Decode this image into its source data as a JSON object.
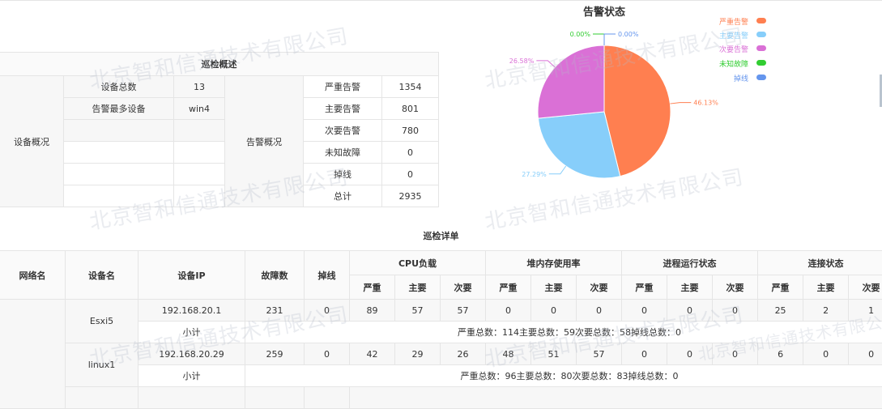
{
  "chart": {
    "title": "告警状态",
    "legend": [
      {
        "label": "严重告警",
        "color": "#ff7f50"
      },
      {
        "label": "主要告警",
        "color": "#87cefa"
      },
      {
        "label": "次要告警",
        "color": "#da70d6"
      },
      {
        "label": "未知故障",
        "color": "#32cd32"
      },
      {
        "label": "掉线",
        "color": "#6495ed"
      }
    ]
  },
  "chart_data": {
    "type": "pie",
    "title": "告警状态",
    "slices": [
      {
        "name": "严重告警",
        "value": 1354,
        "percent": "46.13%",
        "color": "#ff7f50"
      },
      {
        "name": "主要告警",
        "value": 801,
        "percent": "27.29%",
        "color": "#87cefa"
      },
      {
        "name": "次要告警",
        "value": 780,
        "percent": "26.58%",
        "color": "#da70d6"
      },
      {
        "name": "未知故障",
        "value": 0,
        "percent": "0.00%",
        "color": "#32cd32"
      },
      {
        "name": "掉线",
        "value": 0,
        "percent": "0.00%",
        "color": "#6495ed"
      }
    ],
    "legend_position": "top-right"
  },
  "summary": {
    "title": "巡检概述",
    "device_group": "设备概况",
    "device_rows": [
      {
        "label": "设备总数",
        "value": "13"
      },
      {
        "label": "告警最多设备",
        "value": "win4"
      }
    ],
    "alarm_group": "告警概况",
    "alarm_rows": [
      {
        "label": "严重告警",
        "value": "1354"
      },
      {
        "label": "主要告警",
        "value": "801"
      },
      {
        "label": "次要告警",
        "value": "780"
      },
      {
        "label": "未知故障",
        "value": "0"
      },
      {
        "label": "掉线",
        "value": "0"
      },
      {
        "label": "总计",
        "value": "2935"
      }
    ]
  },
  "detail": {
    "title": "巡检详单",
    "headers": {
      "network": "网络名",
      "device": "设备名",
      "ip": "设备IP",
      "faults": "故障数",
      "offline": "掉线",
      "cpu": "CPU负载",
      "heap": "堆内存使用率",
      "process": "进程运行状态",
      "connection": "连接状态",
      "severe": "严重",
      "major": "主要",
      "minor": "次要"
    },
    "rows": [
      {
        "device": "Esxi5",
        "ip": "192.168.20.1",
        "faults": "231",
        "offline": "0",
        "values": [
          "89",
          "57",
          "57",
          "0",
          "0",
          "0",
          "0",
          "0",
          "0",
          "25",
          "2",
          "1"
        ],
        "subtotal_label": "小计",
        "subtotal_text": "严重总数：114主要总数：59次要总数：58掉线总数：0"
      },
      {
        "device": "linux1",
        "ip": "192.168.20.29",
        "faults": "259",
        "offline": "0",
        "values": [
          "42",
          "29",
          "26",
          "48",
          "51",
          "57",
          "0",
          "0",
          "0",
          "6",
          "0",
          "0"
        ],
        "subtotal_label": "小计",
        "subtotal_text": "严重总数：96主要总数：80次要总数：83掉线总数：0"
      }
    ]
  },
  "watermark": "北京智和信通技术有限公司"
}
